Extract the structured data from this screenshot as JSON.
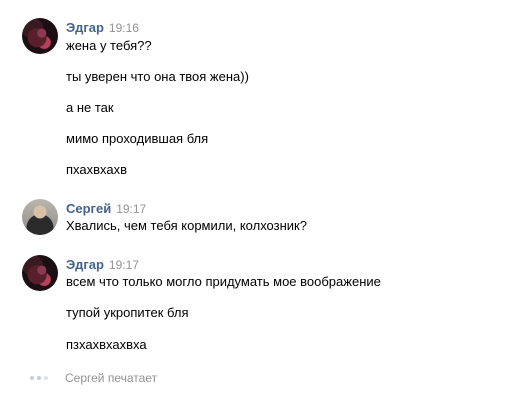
{
  "messages": [
    {
      "author": "Эдгар",
      "avatar": "avatar-edgar",
      "time": "19:16",
      "lines": [
        "жена у тебя??",
        "ты уверен что она твоя жена))",
        "а не так",
        "мимо проходившая бля",
        "пхахвхахв"
      ]
    },
    {
      "author": "Сергей",
      "avatar": "avatar-sergey",
      "time": "19:17",
      "lines": [
        "Хвались, чем тебя кормили, колхозник?"
      ]
    },
    {
      "author": "Эдгар",
      "avatar": "avatar-edgar",
      "time": "19:17",
      "lines": [
        "всем что только могло придумать мое воображение",
        "тупой укропитек бля",
        "пзхахвхахвха"
      ]
    }
  ],
  "typing_indicator": {
    "icon": "typing-dots-icon",
    "text": "Сергей печатает"
  },
  "colors": {
    "author": "#42648b",
    "time": "#939393",
    "text": "#000000"
  }
}
